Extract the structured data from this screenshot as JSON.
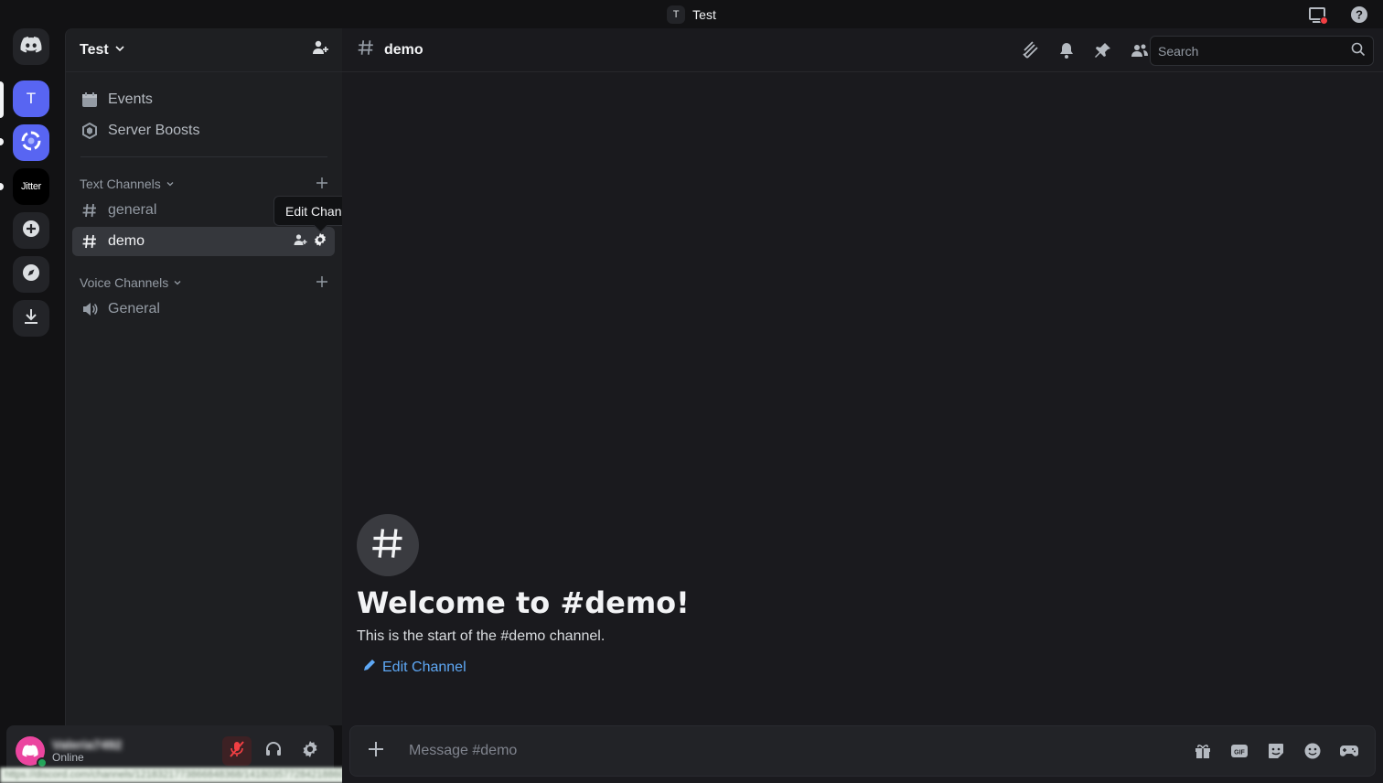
{
  "window": {
    "server_initial": "T",
    "title": "Test"
  },
  "rail": {
    "servers": [
      {
        "name": "discord-home",
        "icon": "discord-logo-icon"
      },
      {
        "name": "Test",
        "initial": "T",
        "color": "#5865f2"
      },
      {
        "name": "purple-server",
        "icon": "swirl-logo-icon",
        "color": "#5865f2"
      },
      {
        "name": "Jitter",
        "label": "Jitter"
      },
      {
        "name": "add-server",
        "icon": "plus-icon"
      },
      {
        "name": "discover",
        "icon": "compass-icon"
      },
      {
        "name": "download",
        "icon": "download-icon"
      }
    ]
  },
  "sidebar": {
    "server_name": "Test",
    "items": [
      {
        "label": "Events",
        "icon": "calendar-icon"
      },
      {
        "label": "Server Boosts",
        "icon": "boost-icon"
      }
    ],
    "text_category": "Text Channels",
    "text_channels": [
      "general",
      "demo"
    ],
    "voice_category": "Voice Channels",
    "voice_channels": [
      "General"
    ],
    "tooltip": "Edit Channel"
  },
  "user": {
    "name": "Valeria7492",
    "status": "Online",
    "status_url": "https://discord.com/channels/1218321773866848368/1418035772842188604"
  },
  "channel": {
    "name": "demo",
    "search_placeholder": "Search",
    "welcome_title": "Welcome to #demo!",
    "welcome_sub": "This is the start of the #demo channel.",
    "edit_link": "Edit Channel",
    "composer_placeholder": "Message #demo"
  },
  "colors": {
    "accent": "#5865f2",
    "link": "#5ea8f5",
    "online": "#23a55a",
    "danger": "#f23f43"
  }
}
